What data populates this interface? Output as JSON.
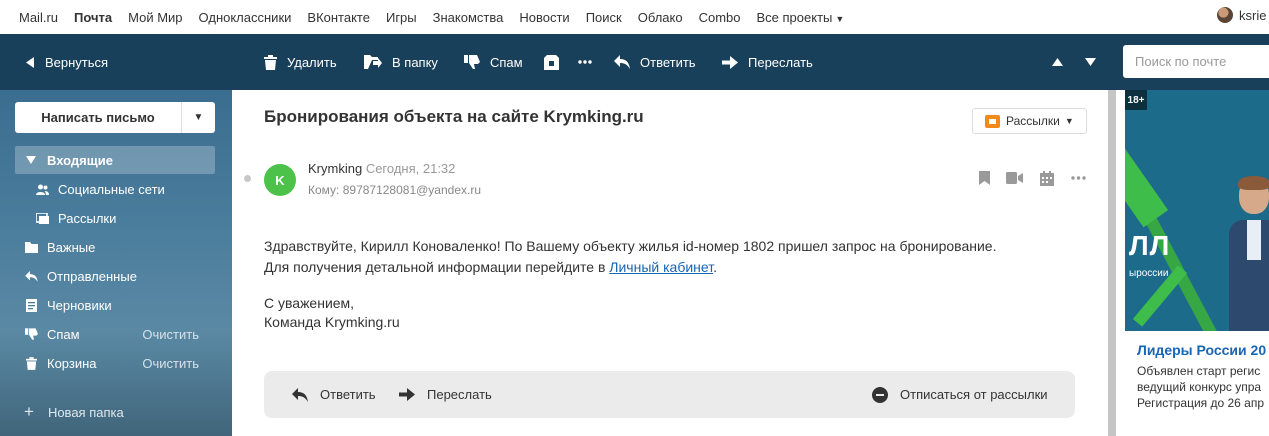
{
  "portal": {
    "links": [
      "Mail.ru",
      "Почта",
      "Мой Мир",
      "Одноклассники",
      "ВКонтакте",
      "Игры",
      "Знакомства",
      "Новости",
      "Поиск",
      "Облако",
      "Combo",
      "Все проекты"
    ],
    "user": "ksrie"
  },
  "toolbar": {
    "back": "Вернуться",
    "delete": "Удалить",
    "move": "В папку",
    "spam": "Спам",
    "reply": "Ответить",
    "forward": "Переслать",
    "search_placeholder": "Поиск по почте"
  },
  "sidebar": {
    "compose": "Написать письмо",
    "folders": [
      {
        "label": "Входящие",
        "icon": "chevron-down-icon"
      },
      {
        "label": "Социальные сети",
        "icon": "people-icon"
      },
      {
        "label": "Рассылки",
        "icon": "newsletter-icon"
      },
      {
        "label": "Важные",
        "icon": "folder-icon"
      },
      {
        "label": "Отправленные",
        "icon": "sent-icon"
      },
      {
        "label": "Черновики",
        "icon": "draft-icon"
      },
      {
        "label": "Спам",
        "icon": "spam-icon",
        "action": "Очистить"
      },
      {
        "label": "Корзина",
        "icon": "trash-icon",
        "action": "Очистить"
      }
    ],
    "new_folder": "Новая папка"
  },
  "message": {
    "subject": "Бронирования объекта на сайте Krymking.ru",
    "tag": "Рассылки",
    "avatar_letter": "K",
    "sender": "Krymking",
    "date": "Сегодня, 21:32",
    "to": "Кому: 89787128081@yandex.ru",
    "body_line1": "Здравствуйте, Кирилл Коноваленко! По Вашему объекту жилья id-номер 1802 пришел запрос на бронирование.",
    "body_line2_prefix": "Для получения детальной информации перейдите в ",
    "body_link": "Личный кабинет",
    "body_line2_suffix": ".",
    "sign1": "С уважением,",
    "sign2": "Команда Krymking.ru",
    "reply": "Ответить",
    "forward": "Переслать",
    "unsubscribe": "Отписаться от рассылки"
  },
  "ad": {
    "age": "18+",
    "image_text": "ЛЛ",
    "image_subtext": "ыроссии",
    "title": "Лидеры России 20",
    "line1": "Объявлен старт регис",
    "line2": "ведущий конкурс упра",
    "line3": "Регистрация до 26 апр"
  },
  "colors": {
    "toolbar": "#19405a",
    "link": "#1865b5",
    "avatar": "#4cc24a",
    "tag": "#f28a1a"
  }
}
